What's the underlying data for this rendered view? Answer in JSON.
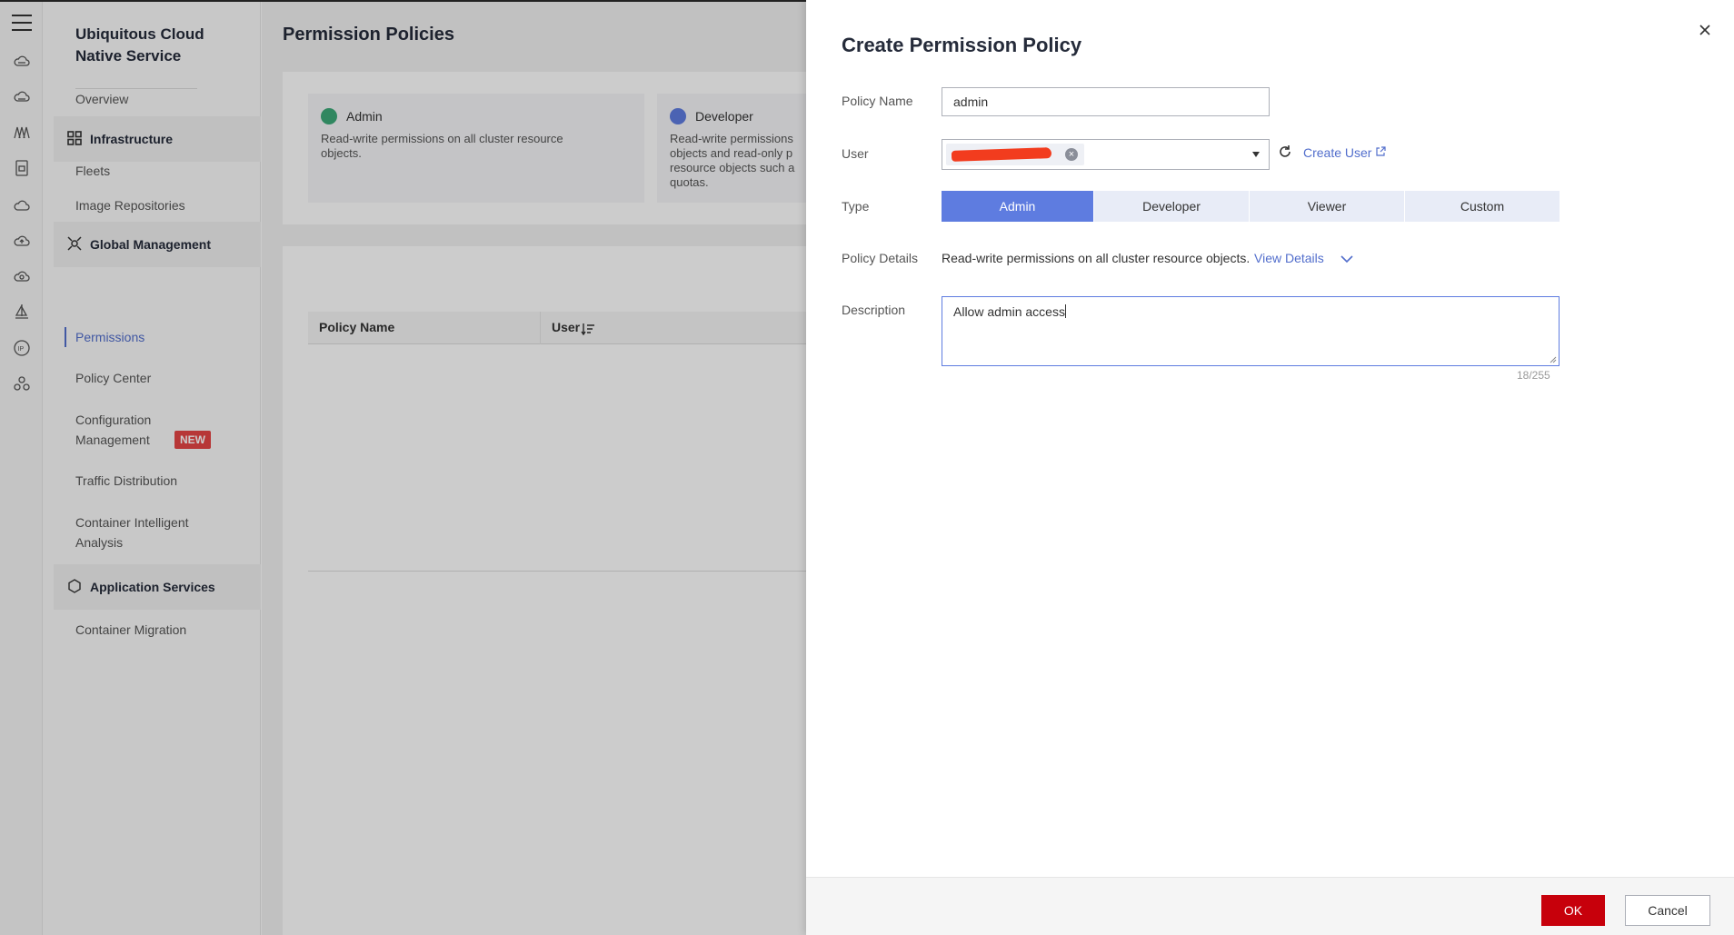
{
  "rail": {
    "icons": [
      "menu-icon",
      "cloud-icon",
      "cloud-server-icon",
      "cluster-icon",
      "storage-icon",
      "cloud-icon",
      "cloud-upload-icon",
      "cloud-sync-icon",
      "sailboat-icon",
      "ip-icon",
      "network-icon"
    ]
  },
  "sidebar": {
    "brand": "Ubiquitous Cloud Native Service",
    "items": {
      "overview": "Overview",
      "infrastructure": "Infrastructure",
      "fleets": "Fleets",
      "image_repositories": "Image Repositories",
      "global_management": "Global Management",
      "permissions": "Permissions",
      "policy_center": "Policy Center",
      "configuration_management_1": "Configuration",
      "configuration_management_2": "Management",
      "new_badge": "NEW",
      "traffic_distribution": "Traffic Distribution",
      "container_analysis_1": "Container Intelligent",
      "container_analysis_2": "Analysis",
      "application_services": "Application Services",
      "container_migration": "Container Migration"
    }
  },
  "main": {
    "title": "Permission Policies",
    "cards": [
      {
        "title": "Admin",
        "desc_1": "Read-write permissions on all cluster resource",
        "desc_2": "objects."
      },
      {
        "title": "Developer",
        "desc_1": "Read-write permissions",
        "desc_2": "objects and read-only p",
        "desc_3": "resource objects such a",
        "desc_4": "quotas."
      }
    ],
    "table_headers": [
      "Policy Name",
      "User"
    ]
  },
  "drawer": {
    "title": "Create Permission Policy",
    "labels": {
      "policy_name": "Policy Name",
      "user": "User",
      "type": "Type",
      "policy_details": "Policy Details",
      "description": "Description"
    },
    "policy_name_value": "admin",
    "create_user": "Create User",
    "type_options": [
      "Admin",
      "Developer",
      "Viewer",
      "Custom"
    ],
    "selected_type": "Admin",
    "policy_details_text": "Read-write permissions on all cluster resource objects.",
    "view_details": "View Details",
    "description_value": "Allow admin access",
    "char_count": "18/255",
    "ok": "OK",
    "cancel": "Cancel"
  },
  "colors": {
    "accent": "#5e7ce0",
    "link": "#526ecc",
    "primary_button": "#c7000b",
    "badge": "#e54545"
  }
}
